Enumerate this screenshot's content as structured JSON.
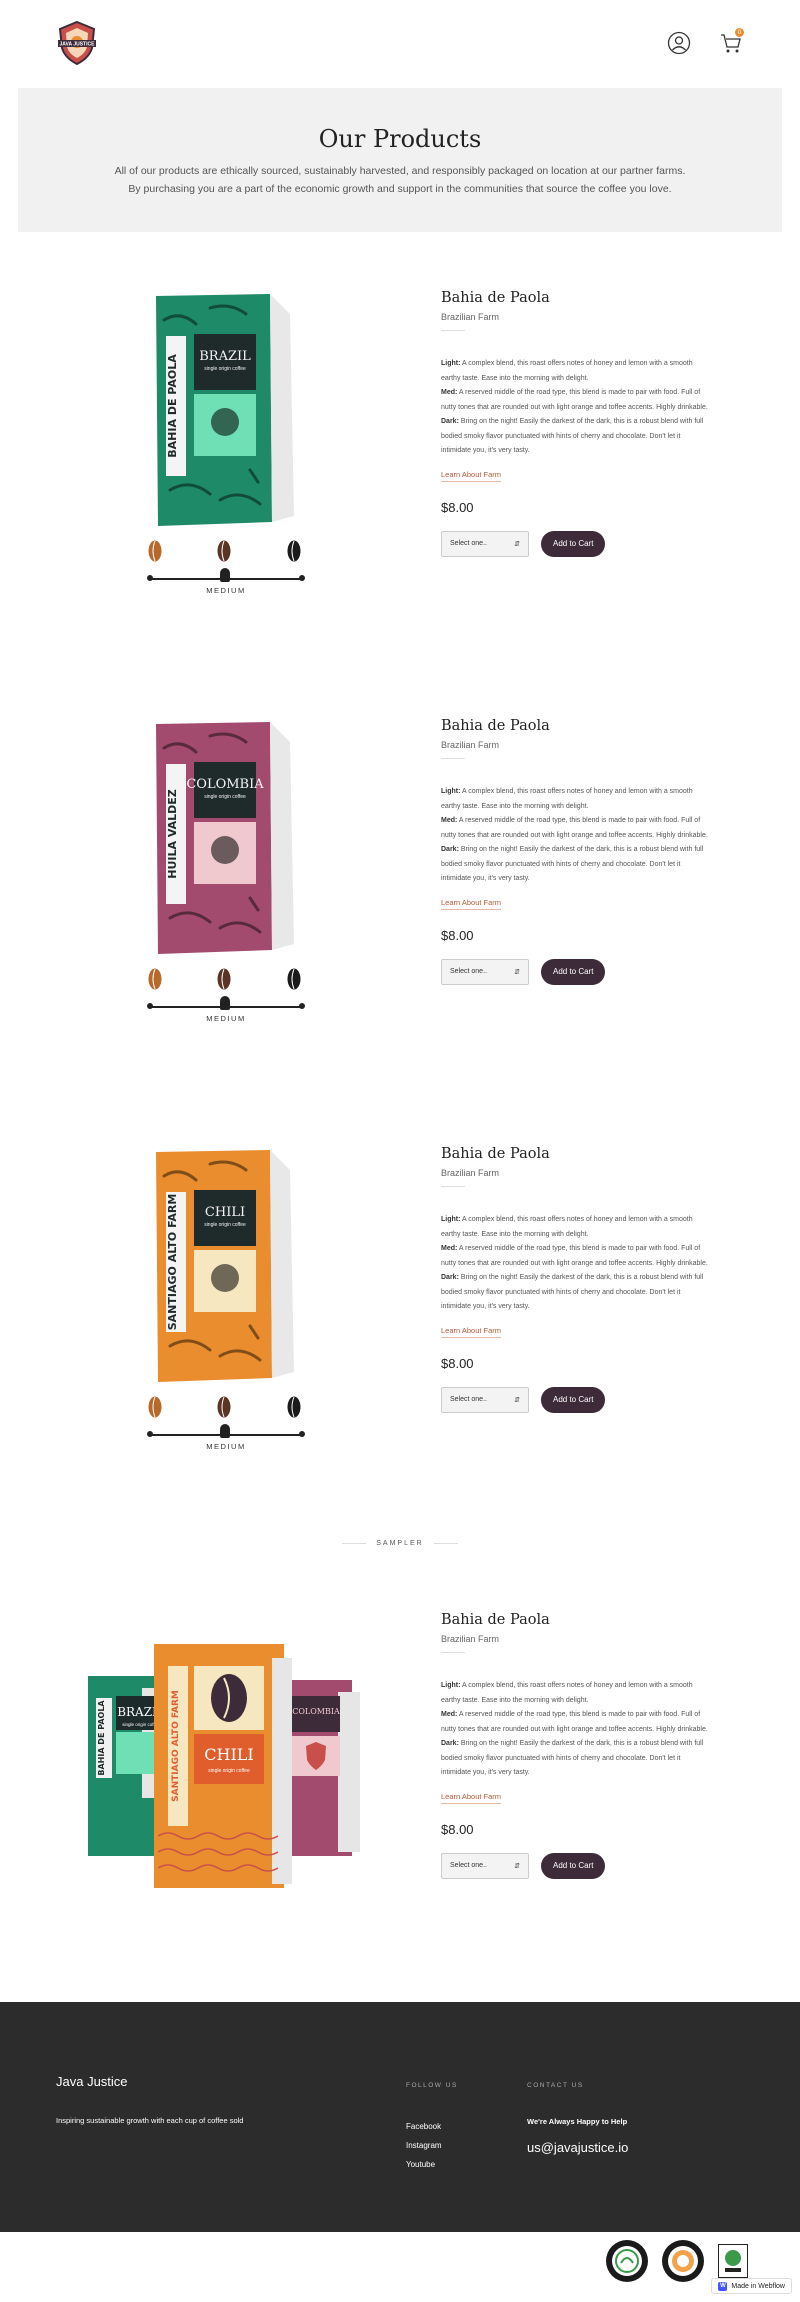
{
  "header": {
    "logo_text": "JAVA JUSTICE",
    "account_icon": "user-circle-icon",
    "cart_icon": "cart-icon",
    "cart_count": "0"
  },
  "hero": {
    "title": "Our Products",
    "line1": "All of our products are ethically sourced, sustainably harvested, and responsibly packaged on location at our partner farms.",
    "line2": "By purchasing you are a part of the economic growth and support in the communities that source the coffee you love."
  },
  "products": [
    {
      "name": "Bahia de Paola",
      "farm": "Brazilian Farm",
      "light_label": "Light:",
      "light_text": "A complex blend, this roast offers notes of honey and lemon with a smooth earthy taste. Ease into the morning with delight.",
      "med_label": "Med:",
      "med_text": "A reserved middle of the road type, this blend is made to pair with food. Full of nutty tones that are rounded out with light orange and toffee accents. Highly drinkable.",
      "dark_label": "Dark:",
      "dark_text": "Bring on the night! Easily the darkest of the dark, this is a robust blend with full bodied smoky flavor punctuated with hints of cherry and chocolate. Don't let it intimidate you, it's very tasty.",
      "learn": "Learn About Farm",
      "price": "$8.00",
      "select": "Select one..",
      "button": "Add to Cart",
      "roast_level": "MEDIUM",
      "bag": {
        "origin": "BRAZIL",
        "sub": "single origin coffee",
        "side": "BAHIA DE PAOLA",
        "color": "#1f8a68",
        "panel": "#6fe0b6"
      }
    },
    {
      "name": "Bahia de Paola",
      "farm": "Brazilian Farm",
      "light_label": "Light:",
      "light_text": "A complex blend, this roast offers notes of honey and lemon with a smooth earthy taste. Ease into the morning with delight.",
      "med_label": "Med:",
      "med_text": "A reserved middle of the road type, this blend is made to pair with food. Full of nutty tones that are rounded out with light orange and toffee accents. Highly drinkable.",
      "dark_label": "Dark:",
      "dark_text": "Bring on the night! Easily the darkest of the dark, this is a robust blend with full bodied smoky flavor punctuated with hints of cherry and chocolate. Don't let it intimidate you, it's very tasty.",
      "learn": "Learn About Farm",
      "price": "$8.00",
      "select": "Select one..",
      "button": "Add to Cart",
      "roast_level": "MEDIUM",
      "bag": {
        "origin": "COLOMBIA",
        "sub": "single origin coffee",
        "side": "HUILA VALDEZ",
        "color": "#a24b6e",
        "panel": "#f0c9cf"
      }
    },
    {
      "name": "Bahia de Paola",
      "farm": "Brazilian Farm",
      "light_label": "Light:",
      "light_text": "A complex blend, this roast offers notes of honey and lemon with a smooth earthy taste. Ease into the morning with delight.",
      "med_label": "Med:",
      "med_text": "A reserved middle of the road type, this blend is made to pair with food. Full of nutty tones that are rounded out with light orange and toffee accents. Highly drinkable.",
      "dark_label": "Dark:",
      "dark_text": "Bring on the night! Easily the darkest of the dark, this is a robust blend with full bodied smoky flavor punctuated with hints of cherry and chocolate. Don't let it intimidate you, it's very tasty.",
      "learn": "Learn About Farm",
      "price": "$8.00",
      "select": "Select one..",
      "button": "Add to Cart",
      "roast_level": "MEDIUM",
      "bag": {
        "origin": "CHILI",
        "sub": "single origin coffee",
        "side": "SANTIAGO ALTO FARM",
        "color": "#e98d2e",
        "panel": "#f7e7c1"
      }
    }
  ],
  "sampler": {
    "label": "SAMPLER",
    "name": "Bahia de Paola",
    "farm": "Brazilian Farm",
    "light_label": "Light:",
    "light_text": "A complex blend, this roast offers notes of honey and lemon with a smooth earthy taste. Ease into the morning with delight.",
    "med_label": "Med:",
    "med_text": "A reserved middle of the road type, this blend is made to pair with food. Full of nutty tones that are rounded out with light orange and toffee accents. Highly drinkable.",
    "dark_label": "Dark:",
    "dark_text": "Bring on the night! Easily the darkest of the dark, this is a robust blend with full bodied smoky flavor punctuated with hints of cherry and chocolate. Don't let it intimidate you, it's very tasty.",
    "learn": "Learn About Farm",
    "price": "$8.00",
    "select": "Select one..",
    "button": "Add to Cart"
  },
  "footer": {
    "brand": "Java Justice",
    "tagline": "Inspiring sustainable growth with each cup of coffee sold",
    "follow_heading": "FOLLOW US",
    "links": [
      "Facebook",
      "Instagram",
      "Youtube"
    ],
    "contact_heading": "CONTACT US",
    "happy": "We're Always Happy to Help",
    "email": "us@javajustice.io"
  },
  "webflow_badge": "Made in Webflow"
}
